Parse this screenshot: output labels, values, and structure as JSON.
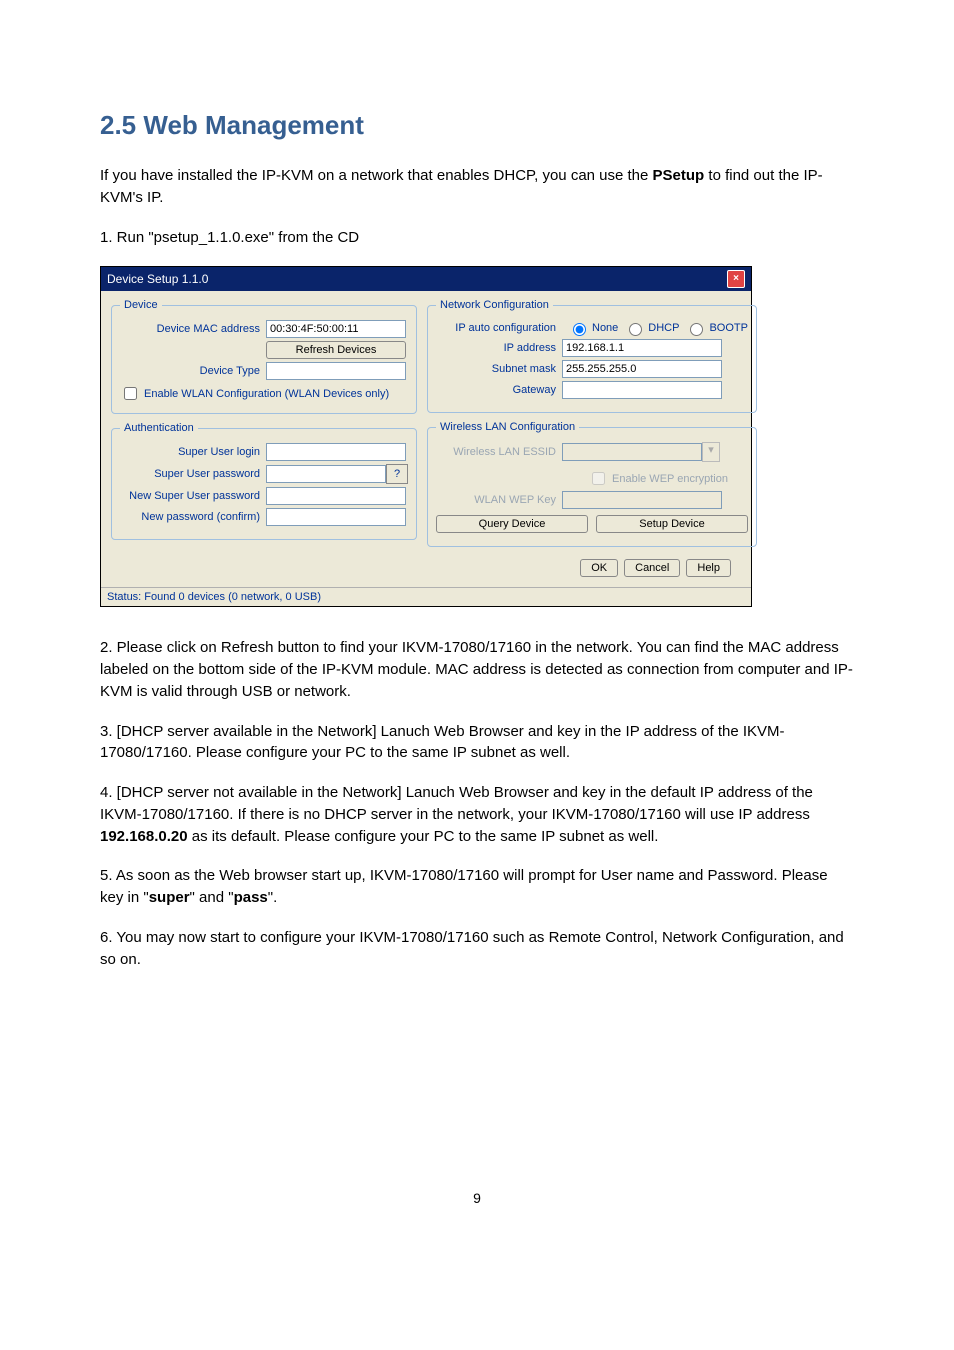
{
  "heading": "2.5 Web Management",
  "intro_a": "If you have installed the IP-KVM on a network that enables DHCP, you can use the ",
  "intro_bold": "PSetup",
  "intro_b": " to find out the IP-KVM's IP.",
  "step1": "1. Run \"psetup_1.1.0.exe\" from the CD",
  "step2": "2.   Please click on Refresh button to find your IKVM-17080/17160 in the network. You can find the MAC address labeled on the bottom side of the IP-KVM module. MAC address is detected as connection from computer and IP-KVM is valid through USB or network.",
  "step3": "3. [DHCP server available in the Network]   Lanuch Web Browser and key in the IP address of the IKVM-17080/17160. Please configure your PC to the same IP subnet as well.",
  "step4_a": "4. [DHCP server not available in the Network] Lanuch Web Browser and key in the default IP address of the IKVM-17080/17160.   If there is no DHCP server in the network, your IKVM-17080/17160 will use IP address ",
  "step4_bold": "192.168.0.20",
  "step4_b": " as its default. Please configure your PC to the same IP subnet as well.",
  "step5_a": "5. As soon as the Web browser start up, IKVM-17080/17160 will prompt for User name and Password. Please key in \"",
  "step5_super": "super",
  "step5_mid": "\"   and \"",
  "step5_pass": "pass",
  "step5_end": "\".",
  "step6": "6. You may now start to configure your IKVM-17080/17160 such as Remote Control, Network Configuration, and so on.",
  "page_number": "9",
  "panel": {
    "title": "Device Setup 1.1.0",
    "close": "×",
    "device": {
      "legend": "Device",
      "mac_label": "Device MAC address",
      "mac_value": "00:30:4F:50:00:11",
      "refresh_btn": "Refresh Devices",
      "type_label": "Device Type",
      "type_value": "",
      "enable_wlan": "Enable WLAN Configuration (WLAN Devices only)"
    },
    "auth": {
      "legend": "Authentication",
      "login_label": "Super User login",
      "pass_label": "Super User password",
      "pass_btn": "?",
      "new_label": "New Super User password",
      "confirm_label": "New password (confirm)"
    },
    "net": {
      "legend": "Network Configuration",
      "auto_label": "IP auto configuration",
      "r_none": "None",
      "r_dhcp": "DHCP",
      "r_bootp": "BOOTP",
      "ip_label": "IP address",
      "ip_value": "192.168.1.1",
      "mask_label": "Subnet mask",
      "mask_value": "255.255.255.0",
      "gw_label": "Gateway",
      "gw_value": ""
    },
    "wlan": {
      "legend": "Wireless LAN Configuration",
      "essid_label": "Wireless LAN ESSID",
      "wep_chk": "Enable WEP encryption",
      "key_label": "WLAN WEP Key",
      "query_btn": "Query Device",
      "setup_btn": "Setup Device"
    },
    "buttons": {
      "ok": "OK",
      "cancel": "Cancel",
      "help": "Help"
    },
    "status": "Status: Found 0 devices (0 network, 0 USB)"
  }
}
